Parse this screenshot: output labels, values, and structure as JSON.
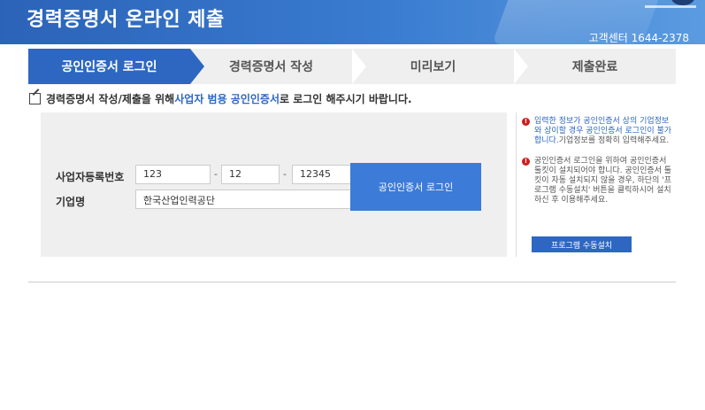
{
  "header": {
    "title": "경력증명서 온라인 제출",
    "customer_center": "고객센터 1644-2378"
  },
  "steps": [
    {
      "label": "공인인증서 로그인",
      "active": true
    },
    {
      "label": "경력증명서 작성",
      "active": false
    },
    {
      "label": "미리보기",
      "active": false
    },
    {
      "label": "제출완료",
      "active": false
    }
  ],
  "notice": {
    "prefix": "경력증명서 작성/제출을 위해 ",
    "highlight": "사업자 범용 공인인증서",
    "suffix": "로 로그인 해주시기 바랍니다."
  },
  "form": {
    "business_number_label": "사업자등록번호",
    "biz_part1": "123",
    "biz_part2": "12",
    "biz_part3": "12345",
    "separator": "-",
    "company_label": "기업명",
    "company_value": "한국산업인력공단",
    "login_button": "공인인증서 로그인"
  },
  "side": {
    "item1_highlight": "입력한 정보가 공인인증서 상의 기업정보와 상이할 경우 공인인증서 로그인이 불가합니다.",
    "item1_rest": "기업정보를 정확히 입력해주세요.",
    "item2": "공인인증서 로그인을 위하여 공인인증서 툴킷이 설치되어야 합니다. 공인인증서 툴킷이 자동 설치되지 않을 경우, 하단의 '프로그램 수동설치' 버튼을 클릭하시어 설치하신 후 이용해주세요.",
    "install_button": "프로그램 수동설치",
    "warn_icon": "!"
  },
  "colors": {
    "primary": "#2d67c2",
    "warning": "#cc1e1e"
  }
}
